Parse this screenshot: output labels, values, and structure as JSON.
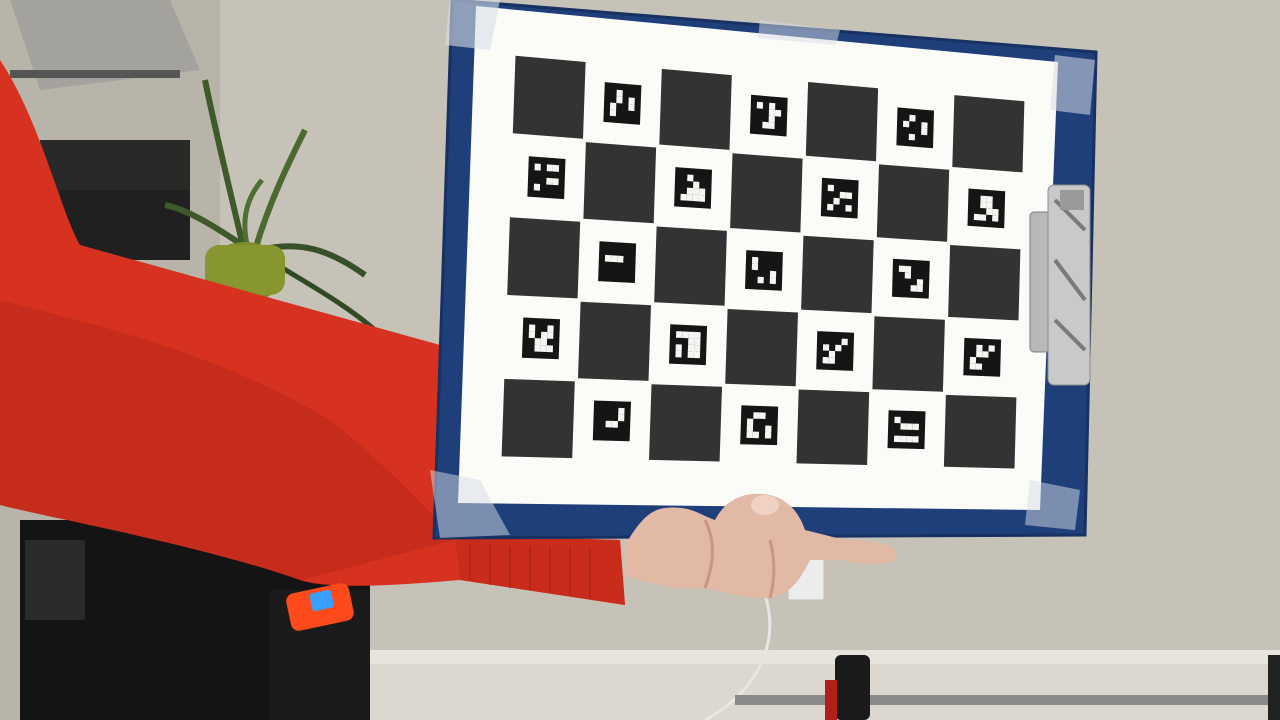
{
  "scene": {
    "description_colors": {
      "wall": "#c7c2b8",
      "floor": "#d8d4cc",
      "sleeve": "#d7321f",
      "sleeve_shadow": "#a62314",
      "clipboard": "#1f3f7a",
      "paper": "#fbfbf8",
      "square": "#333333",
      "skin": "#e2b9a4",
      "clip_metal": "#b8b8b8",
      "plant_leaf": "#3f5a2a",
      "pot": "#7d8a28",
      "device_orange": "#ff4a1c",
      "device_screen": "#3aa0ff"
    }
  },
  "board": {
    "rows": 5,
    "cols": 7,
    "marker_grid_note": "",
    "markers": [
      [
        0,
        1,
        0,
        1,
        0,
        1,
        0
      ],
      [
        1,
        0,
        1,
        0,
        1,
        0,
        1
      ],
      [
        0,
        1,
        0,
        1,
        0,
        1,
        0
      ],
      [
        1,
        0,
        1,
        0,
        1,
        0,
        1
      ],
      [
        0,
        1,
        0,
        1,
        0,
        1,
        0
      ]
    ]
  }
}
